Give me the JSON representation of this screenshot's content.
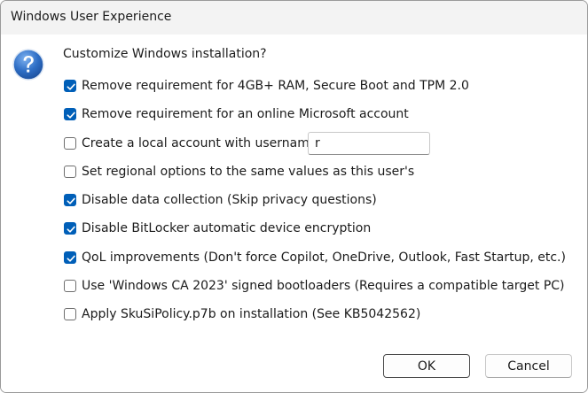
{
  "window": {
    "title": "Windows User Experience"
  },
  "dialog": {
    "prompt": "Customize Windows installation?",
    "icon": "question-icon",
    "options": [
      {
        "label": "Remove requirement for 4GB+ RAM, Secure Boot and TPM 2.0",
        "checked": true
      },
      {
        "label": "Remove requirement for an online Microsoft account",
        "checked": true
      },
      {
        "label": "Create a local account with username:",
        "checked": false
      },
      {
        "label": "Set regional options to the same values as this user's",
        "checked": false
      },
      {
        "label": "Disable data collection (Skip privacy questions)",
        "checked": true
      },
      {
        "label": "Disable BitLocker automatic device encryption",
        "checked": true
      },
      {
        "label": "QoL improvements (Don't force Copilot, OneDrive, Outlook, Fast Startup, etc.)",
        "checked": true
      },
      {
        "label": "Use 'Windows CA 2023' signed bootloaders (Requires a compatible target PC)",
        "checked": false
      },
      {
        "label": "Apply SkuSiPolicy.p7b on installation (See KB5042562)",
        "checked": false
      }
    ],
    "username_value": "r"
  },
  "buttons": {
    "ok_label": "OK",
    "cancel_label": "Cancel"
  },
  "colors": {
    "accent": "#005fb8",
    "titlebar_bg": "#f3f3f3",
    "question_icon_blue": "#2f6fc6"
  }
}
